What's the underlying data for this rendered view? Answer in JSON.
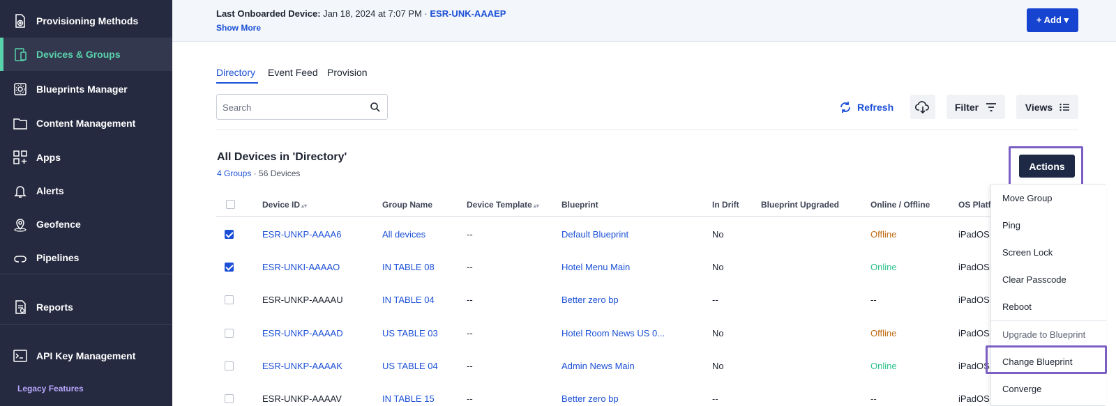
{
  "sidebar": {
    "items": [
      {
        "label": "Provisioning Methods",
        "icon": "provisioning-icon"
      },
      {
        "label": "Devices & Groups",
        "icon": "devices-icon",
        "active": true
      },
      {
        "label": "Blueprints Manager",
        "icon": "blueprint-icon"
      },
      {
        "label": "Content Management",
        "icon": "folder-icon"
      },
      {
        "label": "Apps",
        "icon": "apps-icon"
      },
      {
        "label": "Alerts",
        "icon": "bell-icon"
      },
      {
        "label": "Geofence",
        "icon": "location-icon"
      },
      {
        "label": "Pipelines",
        "icon": "pipeline-icon"
      },
      {
        "label": "Reports",
        "icon": "reports-icon"
      },
      {
        "label": "API Key Management",
        "icon": "terminal-icon"
      }
    ],
    "legacy_label": "Legacy Features"
  },
  "banner": {
    "prefix": "Last Onboarded Device:",
    "date": " Jan 18, 2024 at 7:07 PM · ",
    "device_link": "ESR-UNK-AAAEP",
    "show_more": "Show More",
    "add_label": "+ Add ▾"
  },
  "tabs": [
    "Directory",
    "Event Feed",
    "Provision"
  ],
  "search": {
    "placeholder": "Search"
  },
  "toolbar": {
    "refresh": "Refresh",
    "filter": "Filter",
    "views": "Views"
  },
  "section": {
    "title": "All Devices in 'Directory'",
    "groups": "4 Groups",
    "sep": " · ",
    "devices": "56 Devices",
    "actions": "Actions"
  },
  "table": {
    "headers": [
      "Device ID",
      "Group Name",
      "Device Template",
      "Blueprint",
      "In Drift",
      "Blueprint Upgraded",
      "Online / Offline",
      "OS Platf"
    ],
    "rows": [
      {
        "checked": true,
        "device": "ESR-UNKP-AAAA6",
        "device_link": true,
        "group": "All devices",
        "template": "--",
        "blueprint": "Default Blueprint",
        "drift": "No",
        "status": "Offline",
        "os": "iPadOS"
      },
      {
        "checked": true,
        "device": "ESR-UNKI-AAAAO",
        "device_link": true,
        "group": "IN TABLE 08",
        "template": "--",
        "blueprint": "Hotel Menu Main",
        "drift": "No",
        "status": "Online",
        "os": "iPadOS"
      },
      {
        "checked": false,
        "device": "ESR-UNKP-AAAAU",
        "device_link": false,
        "group": "IN TABLE 04",
        "template": "--",
        "blueprint": "Better zero bp",
        "drift": "--",
        "status": "--",
        "os": "iPadOS"
      },
      {
        "checked": false,
        "device": "ESR-UNKP-AAAAD",
        "device_link": true,
        "group": "US TABLE 03",
        "template": "--",
        "blueprint": "Hotel Room News US 0...",
        "drift": "No",
        "status": "Offline",
        "os": "iPadOS"
      },
      {
        "checked": false,
        "device": "ESR-UNKP-AAAAK",
        "device_link": true,
        "group": "US TABLE 04",
        "template": "--",
        "blueprint": "Admin News Main",
        "drift": "No",
        "status": "Online",
        "os": "iPadOS"
      },
      {
        "checked": false,
        "device": "ESR-UNKP-AAAAV",
        "device_link": false,
        "group": "IN TABLE 15",
        "template": "--",
        "blueprint": "Better zero bp",
        "drift": "--",
        "status": "--",
        "os": "iPadOS"
      }
    ]
  },
  "menu": {
    "items": [
      "Move Group",
      "Ping",
      "Screen Lock",
      "Clear Passcode",
      "Reboot",
      "Upgrade to Blueprint",
      "Change Blueprint",
      "Converge"
    ]
  }
}
